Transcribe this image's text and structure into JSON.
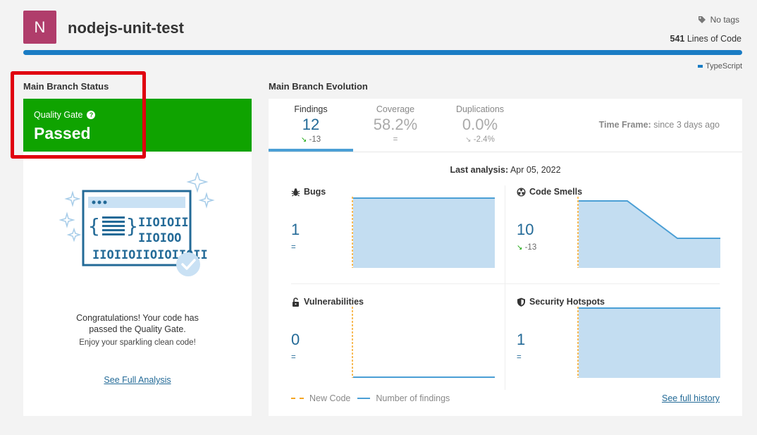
{
  "project": {
    "avatar_letter": "N",
    "name": "nodejs-unit-test",
    "tags": "No tags",
    "loc_count": "541",
    "loc_label": "Lines of Code",
    "language": "TypeScript"
  },
  "status": {
    "section_title": "Main Branch Status",
    "qg_label": "Quality Gate",
    "qg_help": "?",
    "qg_value": "Passed",
    "congrats_line1": "Congratulations! Your code has",
    "congrats_line2": "passed the Quality Gate.",
    "congrats_line3": "Enjoy your sparkling clean code!",
    "see_full_analysis": "See Full Analysis"
  },
  "evolution": {
    "section_title": "Main Branch Evolution",
    "tabs": [
      {
        "label": "Findings",
        "value": "12",
        "delta": "-13",
        "active": true
      },
      {
        "label": "Coverage",
        "value": "58.2%",
        "delta": "=",
        "active": false
      },
      {
        "label": "Duplications",
        "value": "0.0%",
        "delta": "-2.4%",
        "active": false
      }
    ],
    "timeframe_label": "Time Frame:",
    "timeframe_value": "since 3 days ago",
    "last_analysis_label": "Last analysis:",
    "last_analysis_value": "Apr 05, 2022",
    "metrics": [
      {
        "name": "Bugs",
        "icon": "bug-icon",
        "value": "1",
        "delta": "="
      },
      {
        "name": "Code Smells",
        "icon": "radiation-icon",
        "value": "10",
        "delta": "-13"
      },
      {
        "name": "Vulnerabilities",
        "icon": "unlocked-padlock-icon",
        "value": "0",
        "delta": "="
      },
      {
        "name": "Security Hotspots",
        "icon": "shield-icon",
        "value": "1",
        "delta": "="
      }
    ],
    "legend_new_code": "New Code",
    "legend_findings": "Number of findings",
    "see_full_history": "See full history"
  },
  "colors": {
    "quality_gate_passed": "#0fa300",
    "highlight_box": "#e0000f",
    "accent_blue": "#236a97",
    "chart_fill": "#c3ddf1",
    "chart_line": "#4b9fd5",
    "new_code_marker": "#f5a623"
  }
}
